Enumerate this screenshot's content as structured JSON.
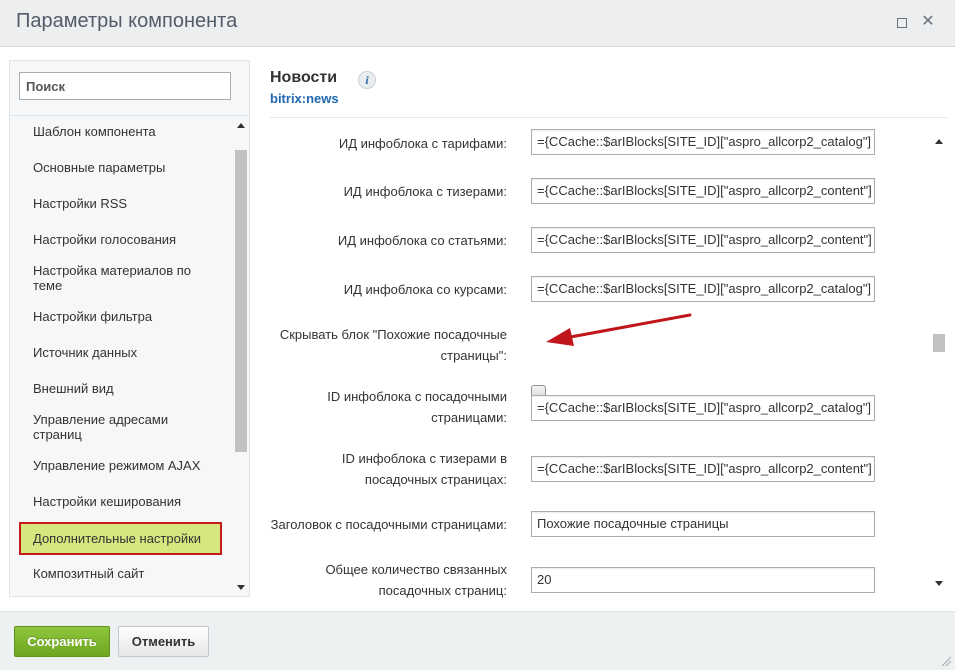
{
  "window": {
    "title": "Параметры компонента",
    "maximize_icon": "maximize-icon",
    "close_icon": "close-icon",
    "close_glyph": "✕"
  },
  "sidebar": {
    "search_placeholder": "Поиск",
    "items": [
      {
        "label": "Шаблон компонента"
      },
      {
        "label": "Основные параметры"
      },
      {
        "label": "Настройки RSS"
      },
      {
        "label": "Настройки голосования"
      },
      {
        "label": "Настройка материалов по теме"
      },
      {
        "label": "Настройки фильтра"
      },
      {
        "label": "Источник данных"
      },
      {
        "label": "Внешний вид"
      },
      {
        "label": "Управление адресами страниц"
      },
      {
        "label": "Управление режимом AJAX"
      },
      {
        "label": "Настройки кеширования"
      },
      {
        "label": "Дополнительные настройки",
        "active": true
      },
      {
        "label": "Композитный сайт"
      }
    ]
  },
  "component": {
    "name": "Новости",
    "code": "bitrix:news",
    "info_icon": "info-icon",
    "info_glyph": "i"
  },
  "form": {
    "rows": [
      {
        "label": "ИД инфоблока с тарифами:",
        "value": "={CCache::$arIBlocks[SITE_ID][\"aspro_allcorp2_catalog\"]"
      },
      {
        "label": "ИД инфоблока с тизерами:",
        "value": "={CCache::$arIBlocks[SITE_ID][\"aspro_allcorp2_content\"]"
      },
      {
        "label": "ИД инфоблока со статьями:",
        "value": "={CCache::$arIBlocks[SITE_ID][\"aspro_allcorp2_content\"]"
      },
      {
        "label": "ИД инфоблока со курсами:",
        "value": "={CCache::$arIBlocks[SITE_ID][\"aspro_allcorp2_catalog\"]"
      },
      {
        "label_line1": "Скрывать блок \"Похожие посадочные",
        "label_line2": "страницы\":",
        "checked": false
      },
      {
        "label_line1": "ID инфоблока с посадочными",
        "label_line2": "страницами:",
        "value": "={CCache::$arIBlocks[SITE_ID][\"aspro_allcorp2_catalog\"]"
      },
      {
        "label_line1": "ID инфоблока с тизерами в",
        "label_line2": "посадочных страницах:",
        "value": "={CCache::$arIBlocks[SITE_ID][\"aspro_allcorp2_content\"]"
      },
      {
        "label": "Заголовок с посадочными страницами:",
        "value": "Похожие посадочные страницы"
      },
      {
        "label_line1": "Общее количество связанных",
        "label_line2": "посадочных страниц:",
        "value": "20"
      }
    ]
  },
  "footer": {
    "save_label": "Сохранить",
    "cancel_label": "Отменить"
  },
  "colors": {
    "save_button": "#7ab52b",
    "active_item_bg": "#d6e77f",
    "highlight_border": "#c41a1a",
    "annotation_arrow": "#c0151b",
    "link": "#2067b0"
  }
}
